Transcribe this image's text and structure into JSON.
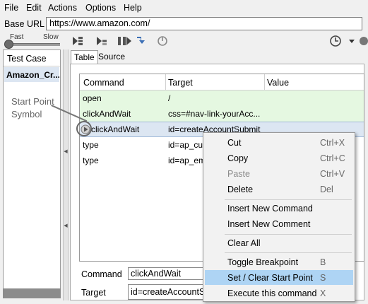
{
  "menubar": {
    "file": "File",
    "edit": "Edit",
    "actions": "Actions",
    "options": "Options",
    "help": "Help"
  },
  "baseurl": {
    "label": "Base URL",
    "value": "https://www.amazon.com/"
  },
  "speed": {
    "fast": "Fast",
    "slow": "Slow"
  },
  "toolbar_icons": [
    "play-all-icon",
    "play-current-icon",
    "pause-icon",
    "step-icon",
    "rollup-icon",
    "timer-icon",
    "clock-icon",
    "dropdown-arrow-icon",
    "record-icon"
  ],
  "testcase": {
    "header": "Test Case",
    "item": "Amazon_Cr..."
  },
  "tabs": {
    "table": "Table",
    "source": "Source"
  },
  "grid": {
    "headers": [
      "Command",
      "Target",
      "Value"
    ],
    "rows": [
      {
        "command": "open",
        "target": "/",
        "value": ""
      },
      {
        "command": "clickAndWait",
        "target": "css=#nav-link-yourAcc...",
        "value": ""
      },
      {
        "command": "clickAndWait",
        "target": "id=createAccountSubmit",
        "value": ""
      },
      {
        "command": "type",
        "target": "id=ap_cu",
        "value": ""
      },
      {
        "command": "type",
        "target": "id=ap_em",
        "value": ""
      }
    ]
  },
  "annotation": {
    "line1": "Start Point",
    "line2": "Symbol"
  },
  "editor": {
    "command_label": "Command",
    "command_value": "clickAndWait",
    "target_label": "Target",
    "target_value": "id=createAccountS"
  },
  "context_menu": {
    "cut": {
      "label": "Cut",
      "shortcut": "Ctrl+X"
    },
    "copy": {
      "label": "Copy",
      "shortcut": "Ctrl+C"
    },
    "paste": {
      "label": "Paste",
      "shortcut": "Ctrl+V"
    },
    "delete": {
      "label": "Delete",
      "shortcut": "Del"
    },
    "insert_command": {
      "label": "Insert New Command"
    },
    "insert_comment": {
      "label": "Insert New Comment"
    },
    "clear_all": {
      "label": "Clear All"
    },
    "toggle_breakpoint": {
      "label": "Toggle Breakpoint",
      "shortcut": "B"
    },
    "set_start_point": {
      "label": "Set / Clear Start Point",
      "shortcut": "S"
    },
    "execute": {
      "label": "Execute this command",
      "shortcut": "X"
    }
  },
  "colors": {
    "executed_row": "#e5f8e1",
    "selected_row": "#dce6f2",
    "menu_highlight": "#aed4f4"
  }
}
